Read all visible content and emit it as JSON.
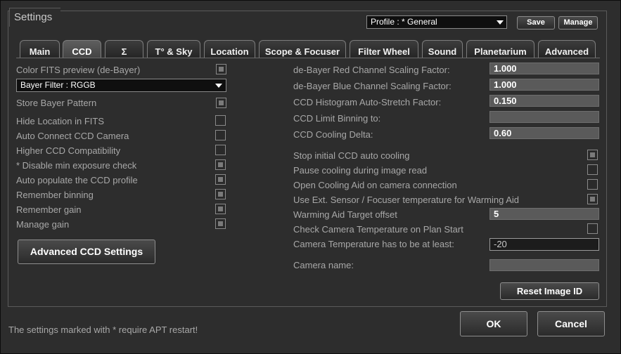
{
  "window": {
    "title": "Settings"
  },
  "profile": {
    "selected": "Profile : * General",
    "save_label": "Save",
    "manage_label": "Manage"
  },
  "tabs": [
    {
      "label": "Main"
    },
    {
      "label": "CCD"
    },
    {
      "label": "Σ"
    },
    {
      "label": "T° & Sky"
    },
    {
      "label": "Location"
    },
    {
      "label": "Scope & Focuser"
    },
    {
      "label": "Filter Wheel"
    },
    {
      "label": "Sound"
    },
    {
      "label": "Planetarium"
    },
    {
      "label": "Advanced"
    }
  ],
  "active_tab": "CCD",
  "left": {
    "color_fits_preview": {
      "label": "Color FITS preview (de-Bayer)",
      "checked": true
    },
    "bayer_filter": {
      "value": "Bayer Filter : RGGB"
    },
    "store_bayer": {
      "label": "Store Bayer Pattern",
      "checked": true
    },
    "options": [
      {
        "label": "Hide Location in FITS",
        "checked": false
      },
      {
        "label": "Auto Connect CCD Camera",
        "checked": false
      },
      {
        "label": "Higher CCD Compatibility",
        "checked": false
      },
      {
        "label": "* Disable min exposure check",
        "checked": true
      },
      {
        "label": "Auto populate the CCD profile",
        "checked": true
      },
      {
        "label": "Remember binning",
        "checked": true
      },
      {
        "label": "Remember gain",
        "checked": true
      },
      {
        "label": "Manage gain",
        "checked": true
      }
    ],
    "advanced_button": "Advanced CCD Settings"
  },
  "right": {
    "fields_top": [
      {
        "label": "de-Bayer Red Channel Scaling Factor:",
        "value": "1.000"
      },
      {
        "label": "de-Bayer Blue Channel Scaling Factor:",
        "value": "1.000"
      },
      {
        "label": "CCD Histogram Auto-Stretch Factor:",
        "value": "0.150"
      },
      {
        "label": "CCD Limit Binning to:",
        "value": ""
      },
      {
        "label": "CCD Cooling Delta:",
        "value": "0.60"
      }
    ],
    "checks": [
      {
        "label": "Stop initial CCD auto cooling",
        "checked": true
      },
      {
        "label": "Pause cooling during image read",
        "checked": false
      },
      {
        "label": "Open Cooling Aid on camera connection",
        "checked": false
      },
      {
        "label": "Use Ext. Sensor / Focuser temperature for Warming Aid",
        "checked": true
      }
    ],
    "warming_offset": {
      "label": "Warming Aid Target offset",
      "value": "5"
    },
    "check_temp": {
      "label": "Check Camera Temperature on Plan Start",
      "checked": false
    },
    "min_temp": {
      "label": "Camera Temperature has to be at least:",
      "value": "-20"
    },
    "camera_name": {
      "label": "Camera name:",
      "value": ""
    },
    "reset_button": "Reset Image ID"
  },
  "footer": {
    "note": "The settings marked with * require APT restart!",
    "ok_label": "OK",
    "cancel_label": "Cancel"
  }
}
